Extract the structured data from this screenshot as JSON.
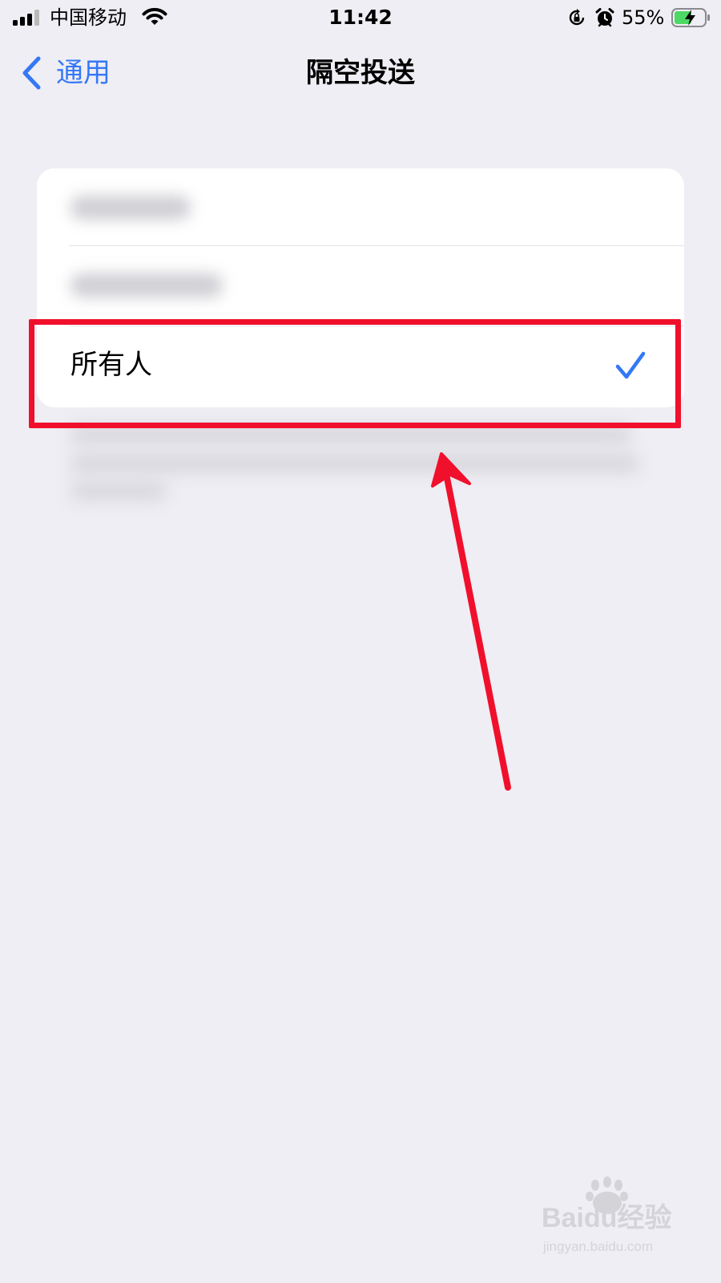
{
  "status_bar": {
    "carrier": "中国移动",
    "time": "11:42",
    "battery_percent": "55%",
    "icons": [
      "signal-icon",
      "wifi-icon",
      "rotation-lock-icon",
      "alarm-icon",
      "battery-charging-icon"
    ]
  },
  "nav": {
    "back_label": "通用",
    "title": "隔空投送"
  },
  "options": {
    "selected_label": "所有人"
  },
  "watermark": {
    "brand": "Baidu经验",
    "url": "jingyan.baidu.com"
  },
  "colors": {
    "accent": "#3478f6",
    "annotation": "#f0102c",
    "background": "#efeef4"
  }
}
